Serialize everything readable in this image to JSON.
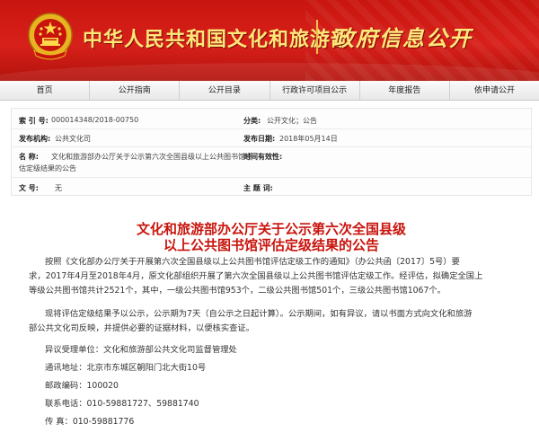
{
  "header": {
    "ministry_name": "中华人民共和国文化和旅游部",
    "subtitle": "政府信息公开",
    "colors": {
      "banner_red": "#d8201a",
      "gold_text": "#ffe87a"
    }
  },
  "nav": {
    "items": [
      "首页",
      "公开指南",
      "公开目录",
      "行政许可项目公示",
      "年度报告",
      "依申请公开"
    ]
  },
  "meta": {
    "index_label": "索 引 号:",
    "index_value": "000014348/2018-00750",
    "category_label": "分类:",
    "category_value": "公开文化；公告",
    "publisher_label": "发布机构:",
    "publisher_value": "公共文化司",
    "date_label": "发布日期:",
    "date_value": "2018年05月14日",
    "name_label": "名    称:",
    "name_value_line1": "文化和旅游部办公厅关于公示第六次全国县级以上公共图书馆评",
    "name_value_line2": "估定级结果的公告",
    "validity_label": "时间有效性:",
    "validity_value": "",
    "docno_label": "文       号:",
    "docno_value": "无",
    "topic_label": "主 题 词:",
    "topic_value": ""
  },
  "article": {
    "title_line1": "文化和旅游部办公厅关于公示第六次全国县级",
    "title_line2": "以上公共图书馆评估定级结果的公告",
    "p1_l1": "按照《文化部办公厅关于开展第六次全国县级以上公共图书馆评估定级工作的通知》（办公共函〔2017〕5号）要",
    "p1_l2": "求，2017年4月至2018年4月，原文化部组织开展了第六次全国县级以上公共图书馆评估定级工作。经评估，拟确定全国上",
    "p1_l3": "等级公共图书馆共计2521个，其中，一级公共图书馆953个，二级公共图书馆501个，三级公共图书馆1067个。",
    "p2_l1": "现将评估定级结果予以公示，公示期为7天（自公示之日起计算）。公示期间，如有异议，请以书面方式向文化和旅游",
    "p2_l2": "部公共文化司反映，并提供必要的证据材料，以便核实查证。",
    "contact_unit": "异议受理单位：文化和旅游部公共文化司监督管理处",
    "contact_address": "通讯地址：北京市东城区朝阳门北大街10号",
    "contact_zip": "邮政编码：100020",
    "contact_phone": "联系电话：010-59881727、59881740",
    "contact_fax": "传        真：010-59881776"
  }
}
